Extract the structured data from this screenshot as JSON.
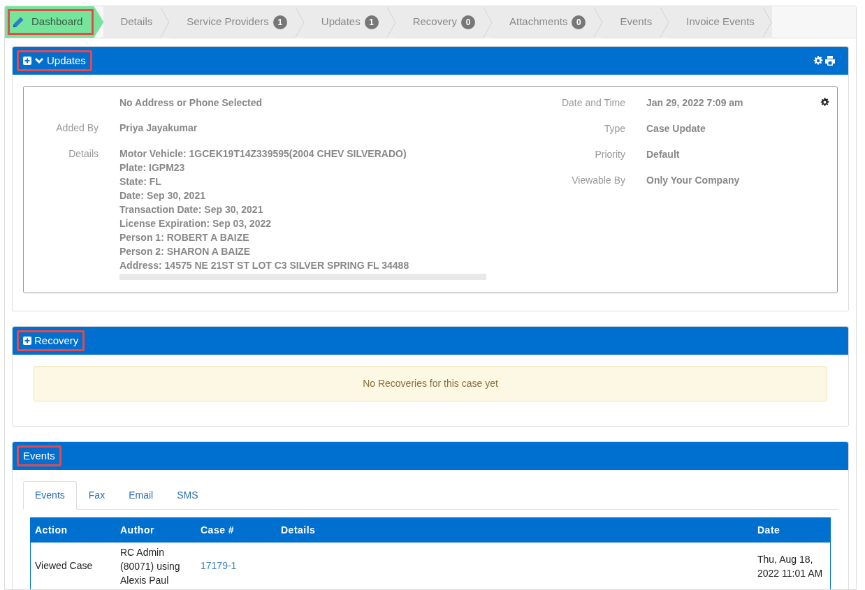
{
  "breadcrumb": [
    {
      "label": "Dashboard",
      "selected": true,
      "highlighted": true
    },
    {
      "label": "Details",
      "selected": false,
      "highlighted": false
    },
    {
      "label": "Service Providers",
      "count": "1",
      "selected": false,
      "highlighted": false
    },
    {
      "label": "Updates",
      "count": "1",
      "selected": false,
      "highlighted": false
    },
    {
      "label": "Recovery",
      "count": "0",
      "selected": false,
      "highlighted": false
    },
    {
      "label": "Attachments",
      "count": "0",
      "selected": false,
      "highlighted": false
    },
    {
      "label": "Events",
      "selected": false,
      "highlighted": false
    },
    {
      "label": "Invoice Events",
      "selected": false,
      "highlighted": false
    }
  ],
  "updates": {
    "title": "Updates",
    "highlighted": true,
    "expanded": true,
    "left_fields": [
      {
        "value": "No Address or Phone Selected"
      },
      {
        "label": "Added By",
        "value": "Priya Jayakumar"
      },
      {
        "label": "Details",
        "lines": [
          "Motor Vehicle: 1GCEK19T14Z339595(2004 CHEV SILVERADO)",
          "Plate: IGPM23",
          "State: FL",
          "Date: Sep 30, 2021",
          "Transaction Date: Sep 30, 2021",
          "License Expiration: Sep 03, 2022",
          "Person 1: ROBERT A BAIZE",
          "Person 2: SHARON A BAIZE",
          "Address: 14575 NE 21ST ST LOT C3 SILVER SPRING FL 34488"
        ]
      }
    ],
    "right_fields": [
      {
        "label": "Date and Time",
        "value": "Jan 29, 2022 7:09 am"
      },
      {
        "label": "Type",
        "value": "Case Update"
      },
      {
        "label": "Priority",
        "value": "Default"
      },
      {
        "label": "Viewable By",
        "value": "Only Your Company"
      }
    ]
  },
  "recovery": {
    "title": "Recovery",
    "highlighted": true,
    "message": "No Recoveries for this case yet"
  },
  "events": {
    "title": "Events",
    "highlighted": true,
    "tabs": [
      {
        "label": "Events",
        "selected": true
      },
      {
        "label": "Fax",
        "selected": false
      },
      {
        "label": "Email",
        "selected": false
      },
      {
        "label": "SMS",
        "selected": false
      }
    ],
    "table": {
      "columns": [
        "Action",
        "Author",
        "Case #",
        "Details",
        "Date"
      ],
      "rows": [
        {
          "action": "Viewed Case",
          "author": "RC Admin (80071) using Alexis Paul",
          "case": "17179-1",
          "date": "Thu, Aug 18, 2022 11:01 AM"
        }
      ]
    }
  }
}
